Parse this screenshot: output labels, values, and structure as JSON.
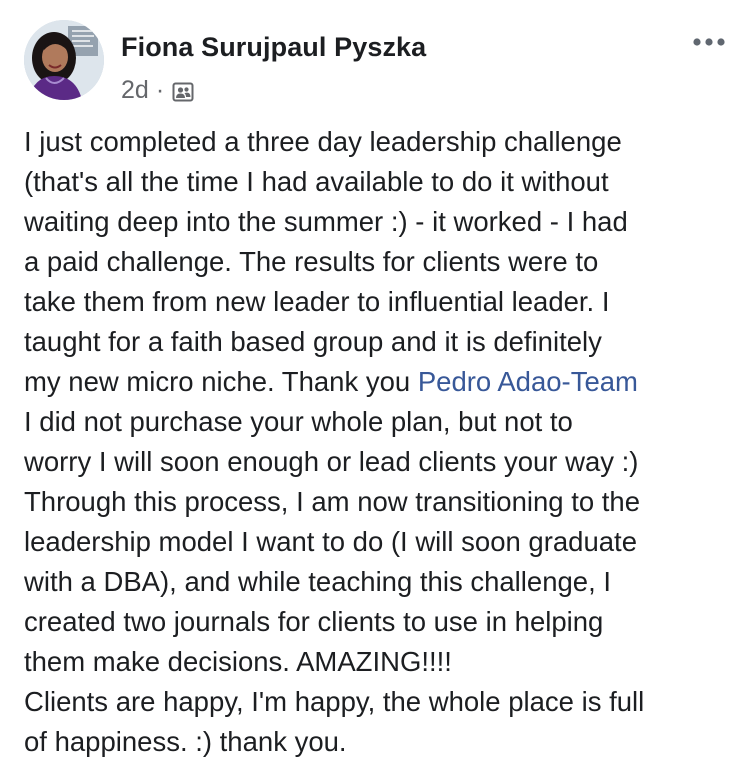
{
  "post": {
    "author": "Fiona Surujpaul Pyszka",
    "time": "2d",
    "separator": "·",
    "privacy_icon": "friends-group-icon",
    "more_icon": "more-options-icon",
    "body_lines": [
      {
        "before": "I just completed a three day leadership challenge"
      },
      {
        "before": "(that's all the time I had available to do it without"
      },
      {
        "before": "waiting deep into the summer :) - it worked - I had"
      },
      {
        "before": "a paid challenge. The results for clients were to"
      },
      {
        "before": "take them from new leader to influential leader. I"
      },
      {
        "before": "taught for a faith based group and it is definitely"
      },
      {
        "before": "my new micro niche. Thank you ",
        "mention": "Pedro Adao-Team"
      },
      {
        "before": "I did not purchase your whole plan, but not to"
      },
      {
        "before": "worry I will soon enough or lead clients your way :)"
      },
      {
        "before": "Through this process, I am now transitioning to the"
      },
      {
        "before": "leadership model I want to do (I will soon graduate"
      },
      {
        "before": "with a DBA), and while teaching this challenge, I"
      },
      {
        "before": "created two journals for clients to use in helping"
      },
      {
        "before": "them make decisions. AMAZING!!!!"
      },
      {
        "before": "Clients are happy, I'm happy, the whole place is full"
      },
      {
        "before": "of happiness. :) thank you."
      }
    ]
  },
  "colors": {
    "text": "#1c1e21",
    "secondary": "#65676b",
    "mention": "#385898"
  }
}
